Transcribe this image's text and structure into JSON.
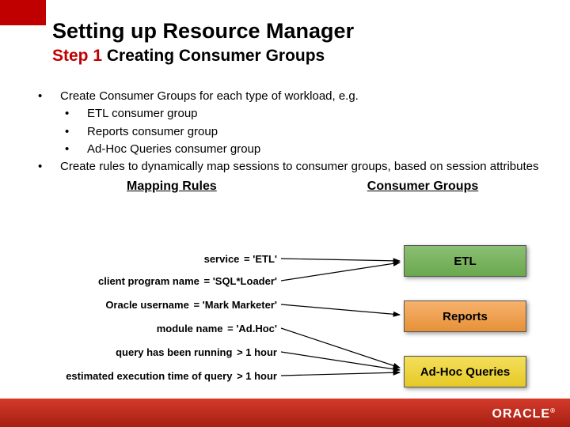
{
  "title": "Setting up Resource Manager",
  "subtitle_step": "Step 1",
  "subtitle_rest": " Creating Consumer Groups",
  "bullets": {
    "b1": "Create Consumer Groups for each type of workload, e.g.",
    "b1a": "ETL consumer group",
    "b1b": "Reports consumer group",
    "b1c": "Ad-Hoc Queries consumer group",
    "b2": "Create rules to dynamically map sessions to consumer groups, based on session attributes"
  },
  "labels": {
    "mapping_rules": "Mapping Rules",
    "consumer_groups": "Consumer Groups"
  },
  "rules": {
    "r1": {
      "attr": "service",
      "val": "= 'ETL'"
    },
    "r2": {
      "attr": "client program name",
      "val": "= 'SQL*Loader'"
    },
    "r3": {
      "attr": "Oracle username",
      "val": "= 'Mark Marketer'"
    },
    "r4": {
      "attr": "module name",
      "val": "= 'Ad.Hoc'"
    },
    "r5": {
      "attr": "query has been running",
      "val": "> 1 hour"
    },
    "r6": {
      "attr": "estimated execution time of query",
      "val": "> 1 hour"
    }
  },
  "groups": {
    "etl": "ETL",
    "reports": "Reports",
    "adhoc": "Ad-Hoc Queries"
  },
  "footer": {
    "logo": "ORACLE",
    "tm": "®"
  }
}
